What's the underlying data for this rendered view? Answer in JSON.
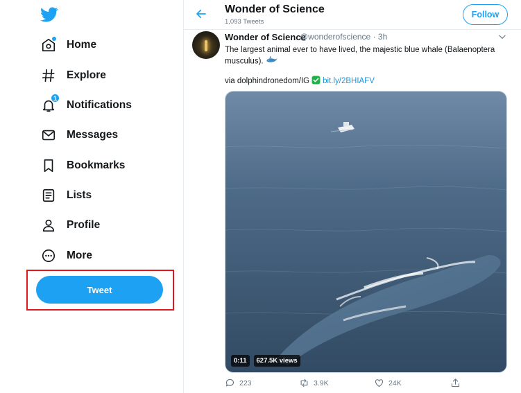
{
  "nav": [
    {
      "id": "home",
      "label": "Home",
      "icon": "home-icon"
    },
    {
      "id": "explore",
      "label": "Explore",
      "icon": "hashtag-icon"
    },
    {
      "id": "notifications",
      "label": "Notifications",
      "icon": "bell-icon",
      "badge": "1"
    },
    {
      "id": "messages",
      "label": "Messages",
      "icon": "envelope-icon"
    },
    {
      "id": "bookmarks",
      "label": "Bookmarks",
      "icon": "bookmark-icon"
    },
    {
      "id": "lists",
      "label": "Lists",
      "icon": "list-icon"
    },
    {
      "id": "profile",
      "label": "Profile",
      "icon": "person-icon"
    },
    {
      "id": "more",
      "label": "More",
      "icon": "more-circle-icon"
    }
  ],
  "tweet_button_label": "Tweet",
  "header": {
    "title": "Wonder of Science",
    "subtitle": "1,093 Tweets",
    "follow_label": "Follow"
  },
  "tweet": {
    "name": "Wonder of Science",
    "handle_time": "@wonderofscience · 3h",
    "text": "The largest animal ever to have lived, the majestic blue whale (Balaenoptera musculus).",
    "via": "via dolphindronedom/IG",
    "link": "bit.ly/2BHIAFV",
    "duration": "0:11",
    "views": "627.5K views",
    "replies": "223",
    "retweets": "3.9K",
    "likes": "24K"
  },
  "colors": {
    "accent": "#1da1f2",
    "highlight_border": "#e0161d",
    "ocean": "#3f5a75"
  }
}
